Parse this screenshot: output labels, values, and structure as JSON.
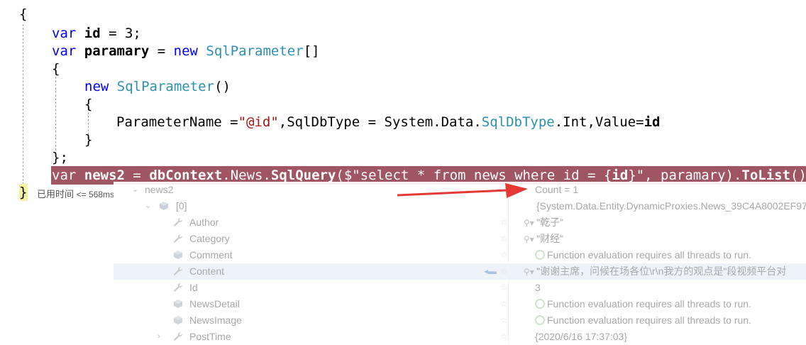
{
  "code": {
    "open_brace": "{",
    "line1": {
      "kw": "var",
      "name": "id",
      "rest": " = 3;"
    },
    "line2": {
      "kw": "var",
      "name": "paramary",
      "eq": " = ",
      "kw_new": "new",
      "type": "SqlParameter",
      "rest": "[]"
    },
    "line3": "{",
    "line4": {
      "kw_new": "new",
      "type": "SqlParameter",
      "rest": "()"
    },
    "line5": "{",
    "line6": {
      "p1": "ParameterName =",
      "str": "\"@id\"",
      "p2": ",SqlDbType = System.Data.",
      "type": "SqlDbType",
      "p3": ".Int,Value=",
      "name": "id"
    },
    "line7": "}",
    "line8": "};",
    "line9": {
      "kw": "var",
      "name": "news2",
      "p1": " = ",
      "obj": "dbContext",
      "p2": ".News.",
      "method": "SqlQuery",
      "p3": "($\"select * from news where id = {",
      "id": "id",
      "p4": "}\", paramary).",
      "tolist": "ToList",
      "p5": "()"
    },
    "close_brace": "}",
    "perf_label": "已用时间",
    "perf_value": "<= 568ms"
  },
  "datatip": {
    "root": {
      "name": "news2",
      "value": "Count = 1"
    },
    "item0": {
      "name": "[0]",
      "value": "{System.Data.Entity.DynamicProxies.News_39C4A8002EF97"
    },
    "properties": [
      {
        "name": "Author",
        "value": "\"乾子\"",
        "icon": "wrench-icon",
        "mag": true
      },
      {
        "name": "Category",
        "value": "\"财经\"",
        "icon": "wrench-icon",
        "mag": true
      },
      {
        "name": "Comment",
        "value": "Function evaluation requires all threads to run.",
        "icon": "cube-icon",
        "refresh": true
      },
      {
        "name": "Content",
        "value": "\"谢谢主席，问候在场各位\\r\\n我方的观点是\"段视频平台对",
        "icon": "wrench-icon",
        "mag": true
      },
      {
        "name": "Id",
        "value": "3",
        "icon": "wrench-icon"
      },
      {
        "name": "NewsDetail",
        "value": "Function evaluation requires all threads to run.",
        "icon": "cube-icon",
        "refresh": true
      },
      {
        "name": "NewsImage",
        "value": "Function evaluation requires all threads to run.",
        "icon": "cube-icon",
        "refresh": true
      },
      {
        "name": "PostTime",
        "value": "{2020/6/16 17:37:03}",
        "icon": "wrench-icon"
      }
    ]
  },
  "colors": {
    "highlight": "#a05562",
    "keyword": "#0000ff",
    "type": "#2b91af",
    "string": "#a31515",
    "arrow": "#e53935"
  }
}
